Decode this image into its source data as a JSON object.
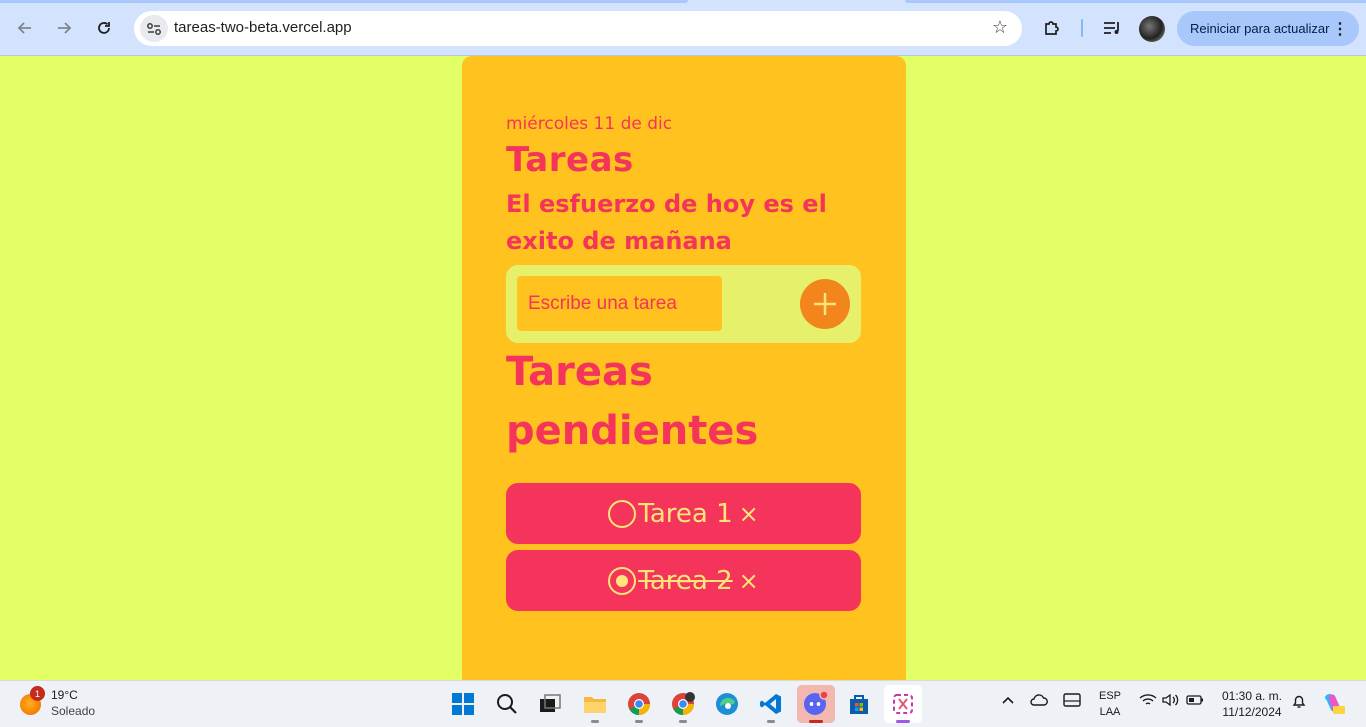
{
  "browser": {
    "url": "tareas-two-beta.vercel.app",
    "restart_label": "Reiniciar para actualizar",
    "icons": [
      "back-icon",
      "forward-icon",
      "reload-icon",
      "site-info-icon",
      "bookmark-star-icon",
      "extensions-icon",
      "media-control-icon",
      "profile-avatar",
      "menu-kebab-icon"
    ]
  },
  "app": {
    "date": "miércoles 11 de dic",
    "title": "Tareas",
    "motto": "El esfuerzo de hoy es el exito de mañana",
    "input_placeholder": "Escribe una tarea",
    "pending_title": "Tareas pendientes",
    "tasks": [
      {
        "label": "Tarea 1",
        "completed": false,
        "delete": "×"
      },
      {
        "label": "Tarea 2",
        "completed": true,
        "delete": "×"
      }
    ],
    "colors": {
      "page_bg": "#e2ff66",
      "card_bg": "#ffc21e",
      "accent_pink": "#f4345a",
      "add_button": "#f2851b",
      "task_text": "#ffe57a"
    }
  },
  "taskbar": {
    "weather": {
      "temp": "19°C",
      "condition": "Soleado",
      "badge": "1"
    },
    "apps": [
      "start-icon",
      "search-icon",
      "task-view-icon",
      "file-explorer-icon",
      "chrome-icon",
      "chrome-profile-icon",
      "edge-icon",
      "vscode-icon",
      "discord-icon",
      "store-icon",
      "snipping-tool-icon"
    ],
    "language": {
      "line1": "ESP",
      "line2": "LAA"
    },
    "time": "01:30 a. m.",
    "date": "11/12/2024"
  }
}
